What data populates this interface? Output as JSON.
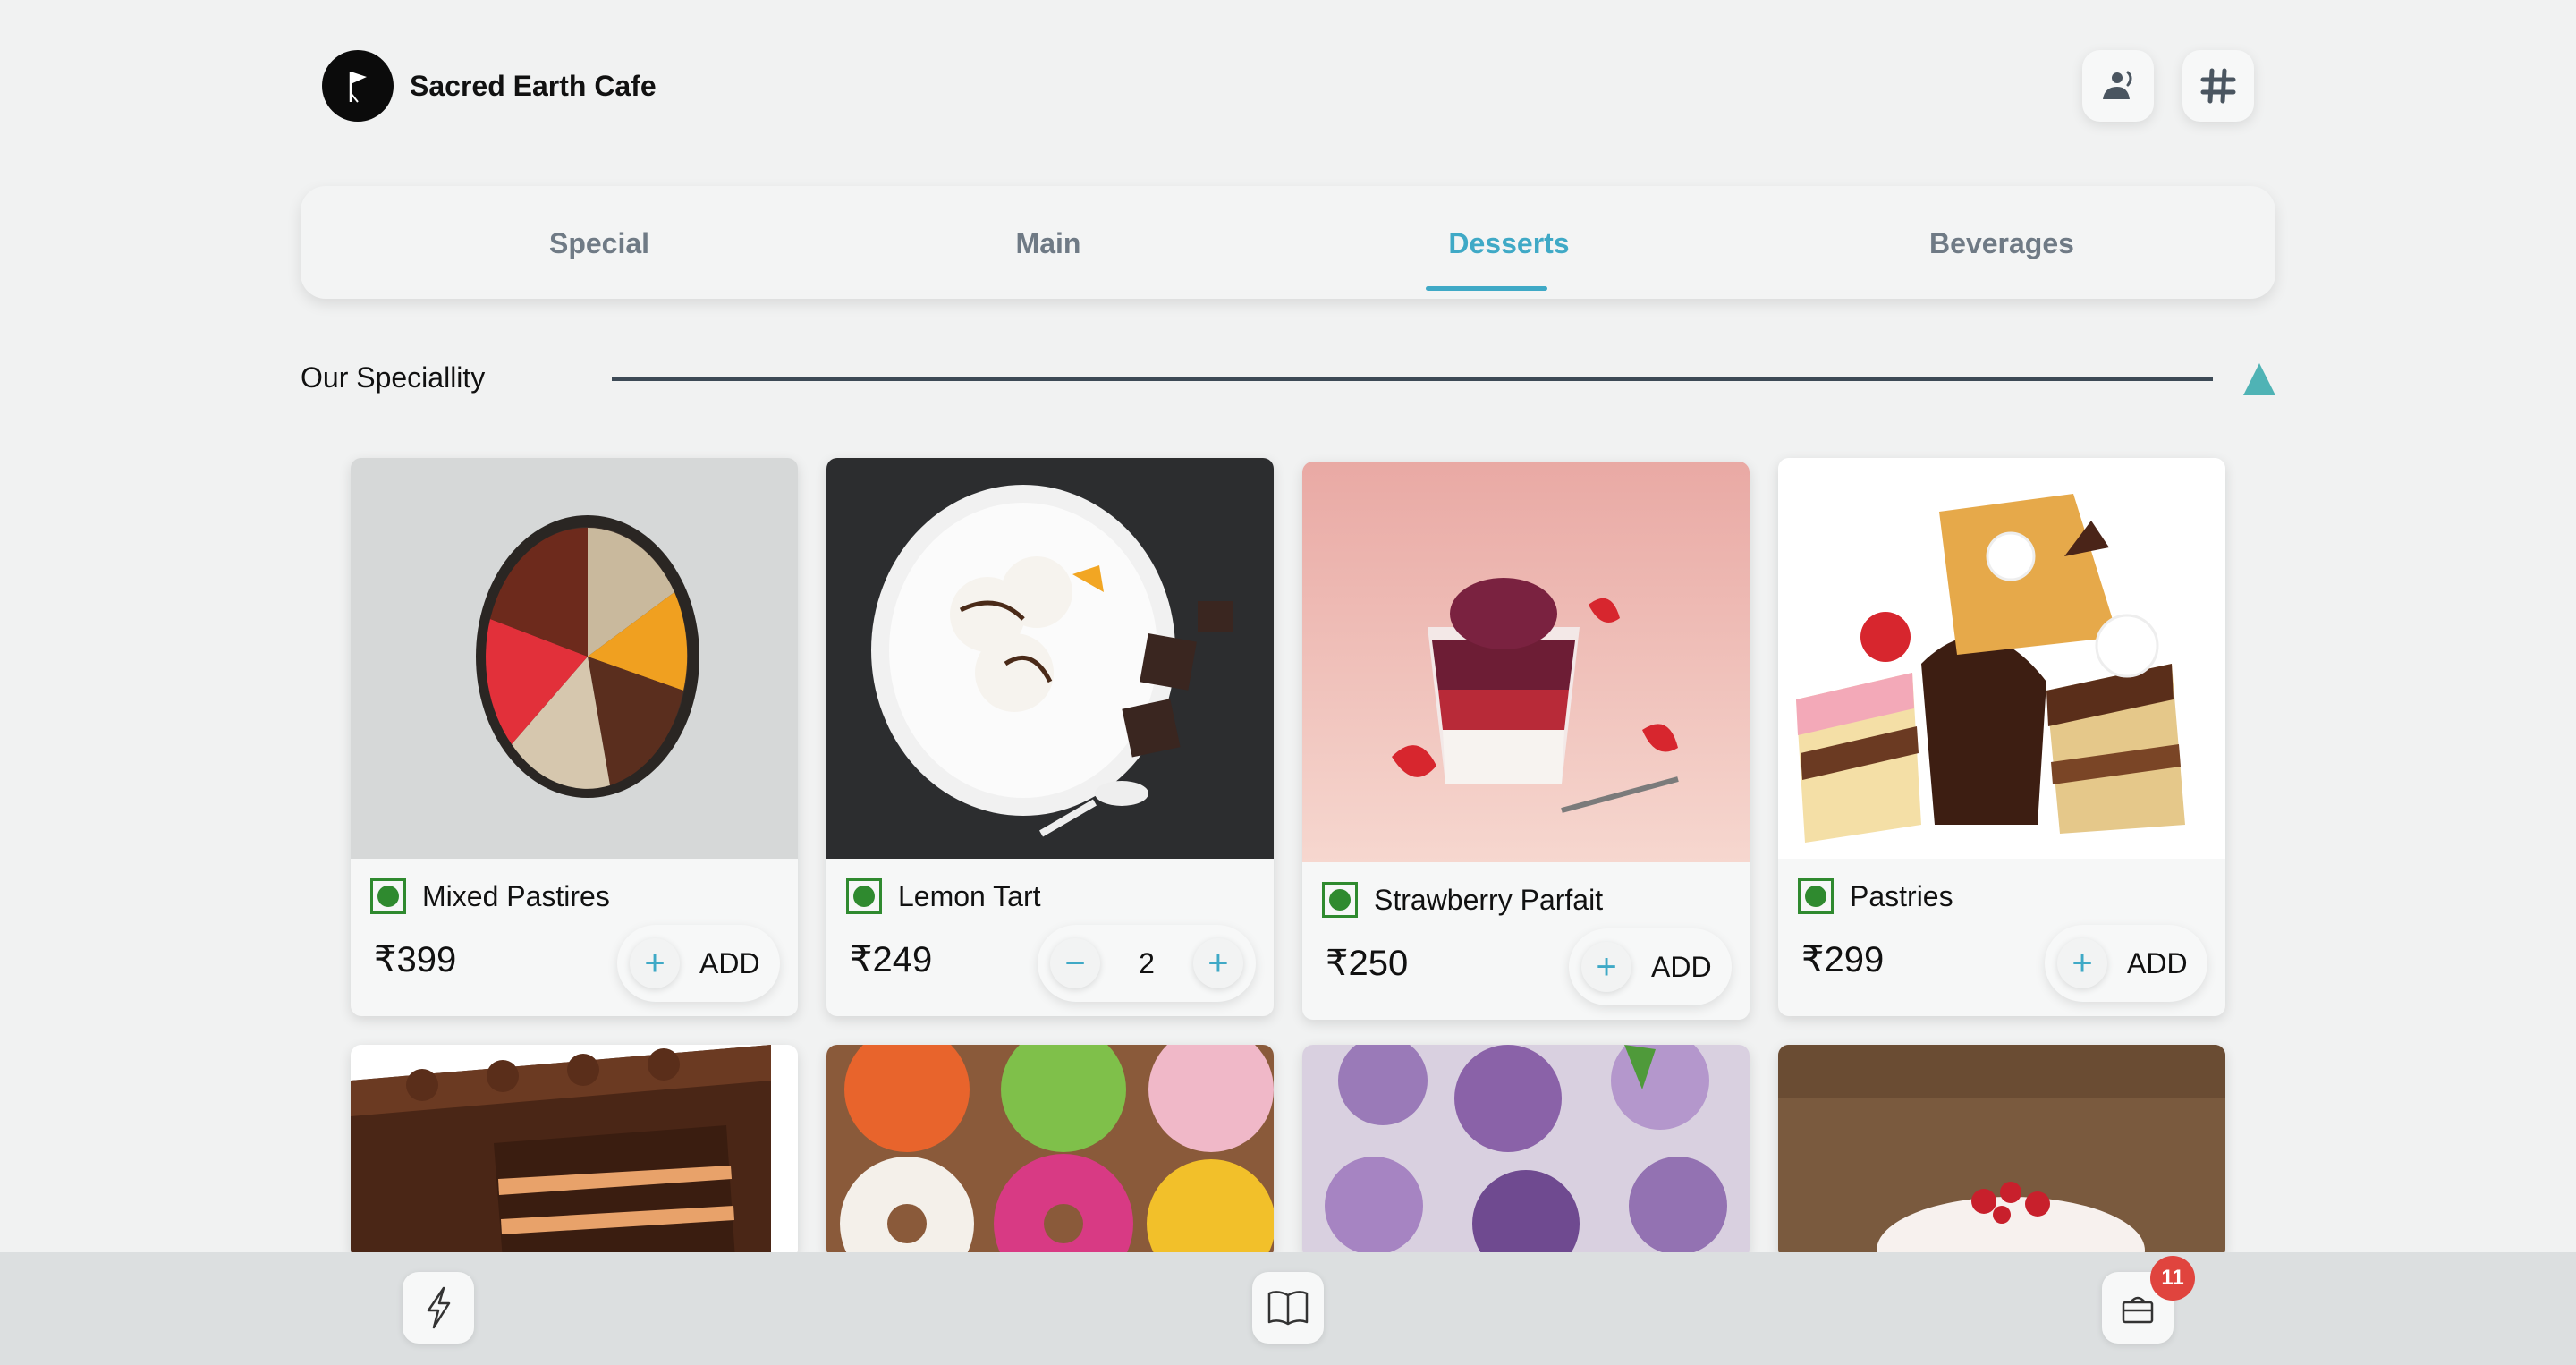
{
  "header": {
    "brand_name": "Sacred Earth Cafe",
    "actions": [
      {
        "icon": "call-waiter-icon"
      },
      {
        "icon": "table-number-icon"
      }
    ]
  },
  "tabs": [
    {
      "label": "Special",
      "active": false
    },
    {
      "label": "Main",
      "active": false
    },
    {
      "label": "Desserts",
      "active": true
    },
    {
      "label": "Beverages",
      "active": false
    }
  ],
  "section": {
    "title": "Our Speciallity",
    "collapse_icon": "triangle-up-icon"
  },
  "items": [
    {
      "name": "Mixed Pastires",
      "price": "₹399",
      "add_label": "ADD",
      "veg": true
    },
    {
      "name": "Lemon Tart",
      "price": "₹249",
      "quantity": "2",
      "veg": true
    },
    {
      "name": "Strawberry Parfait",
      "price": "₹250",
      "add_label": "ADD",
      "veg": true
    },
    {
      "name": "Pastries",
      "price": "₹299",
      "add_label": "ADD",
      "veg": true
    }
  ],
  "next_row_images": [
    "chocolate-cake",
    "donuts",
    "cupcakes",
    "red-velvet-cupcake"
  ],
  "bottom_nav": [
    {
      "icon": "lightning-icon"
    },
    {
      "icon": "menu-book-icon"
    },
    {
      "icon": "cart-bag-icon",
      "badge": "11"
    }
  ],
  "colors": {
    "accent": "#3fa9c6",
    "veg": "#2f8a2f",
    "badge": "#e0443e",
    "background": "#f1f2f2"
  }
}
